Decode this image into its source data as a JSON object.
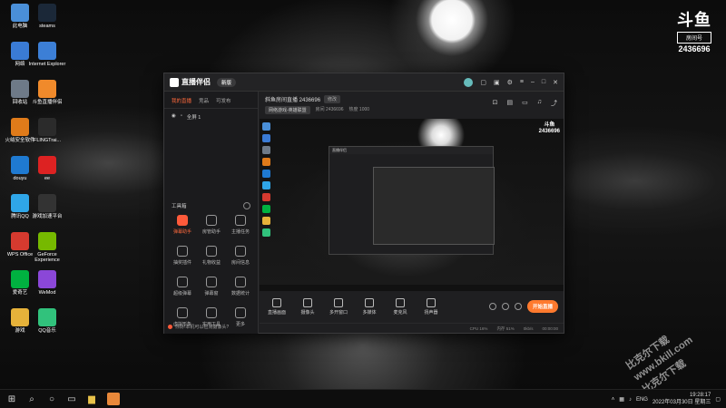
{
  "desktop": {
    "icons": [
      {
        "label": "此电脑",
        "color": "#4a8fd8"
      },
      {
        "label": "steams",
        "color": "#1b2838"
      },
      {
        "label": "网络",
        "color": "#3a7bd5"
      },
      {
        "label": "Internet Explorer",
        "color": "#3c7fd6"
      },
      {
        "label": "回收站",
        "color": "#6e7a88"
      },
      {
        "label": "斗鱼直播伴侣",
        "color": "#f08a2b"
      },
      {
        "label": "火绒安全软件",
        "color": "#e07b1a"
      },
      {
        "label": "FLINGTrai...",
        "color": "#2b2b2b"
      },
      {
        "label": "douyu",
        "color": "#1f7ad1"
      },
      {
        "label": "ee",
        "color": "#d22"
      },
      {
        "label": "腾讯QQ",
        "color": "#2fa6e8"
      },
      {
        "label": "游戏加速平台",
        "color": "#333"
      },
      {
        "label": "WPS Office",
        "color": "#d63a2f"
      },
      {
        "label": "GeForce Experience",
        "color": "#76b900"
      },
      {
        "label": "爱奇艺",
        "color": "#00b140"
      },
      {
        "label": "WeMod",
        "color": "#8b47d8"
      },
      {
        "label": "游戏",
        "color": "#e6b23a"
      },
      {
        "label": "QQ音乐",
        "color": "#31c27c"
      }
    ],
    "douyu_logo": {
      "mark": "斗鱼",
      "room_label": "房间号",
      "room_number": "2436696"
    },
    "watermark": {
      "line1": "比克尔下载",
      "line2": "www.bkill.com",
      "line3": "比克尔下载"
    }
  },
  "taskbar": {
    "tray_lang": "ENG",
    "time": "19:28:17",
    "date": "2022年03月30日 星期三"
  },
  "app": {
    "name": "直播伴侣",
    "version": "新版",
    "sidebar": {
      "tabs": [
        "我的直播",
        "竞品",
        "可发布"
      ],
      "scene": "全屏 1",
      "tools_title": "工具箱",
      "tools": [
        "弹幕助手",
        "房管助手",
        "主播任务",
        "抽奖插件",
        "礼物收益",
        "房间信息",
        "超级弹幕",
        "弹幕窗",
        "数据统计",
        "虚拟形象",
        "实用工具",
        "更多"
      ],
      "footer": "你好!本机可以检测摄像头?"
    },
    "room": {
      "title": "斜鱼房间直播 2436696",
      "edit": "修改",
      "category": "网络游戏-英雄联盟",
      "room_id": "房间 2436696",
      "hot": "热度 1000"
    },
    "preview": {
      "tag_mark": "斗鱼",
      "tag_number": "2436696",
      "nested_title": "直播伴侣"
    },
    "controls": [
      "直播画面",
      "摄像头",
      "多开窗口",
      "多媒体",
      "麦克风",
      "扬声器"
    ],
    "go_live": "开始直播",
    "status": {
      "cpu": "CPU 16%",
      "mem": "内存 51%",
      "bitrate": "0kb/s",
      "time": "00:00:00"
    }
  }
}
